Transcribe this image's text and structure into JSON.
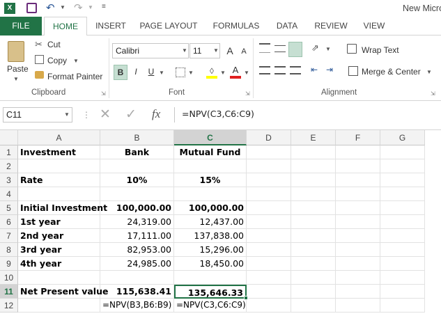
{
  "title_bar": {
    "title": "New Micro"
  },
  "tabs": [
    "FILE",
    "HOME",
    "INSERT",
    "PAGE LAYOUT",
    "FORMULAS",
    "DATA",
    "REVIEW",
    "VIEW"
  ],
  "clipboard": {
    "paste": "Paste",
    "cut": "Cut",
    "copy": "Copy",
    "format_painter": "Format Painter",
    "label": "Clipboard"
  },
  "font": {
    "name": "Calibri",
    "size": "11",
    "label": "Font",
    "grow": "A",
    "shrink": "A",
    "bold": "B",
    "italic": "I",
    "underline": "U"
  },
  "alignment": {
    "wrap_text": "Wrap Text",
    "merge_center": "Merge & Center",
    "label": "Alignment"
  },
  "formula_bar": {
    "name_box": "C11",
    "fx": "fx",
    "formula": "=NPV(C3,C6:C9)"
  },
  "columns": [
    "A",
    "B",
    "C",
    "D",
    "E",
    "F",
    "G"
  ],
  "rows": [
    "1",
    "2",
    "3",
    "4",
    "5",
    "6",
    "7",
    "8",
    "9",
    "10",
    "11",
    "12"
  ],
  "cells": {
    "A1": "Investment",
    "B1": "Bank",
    "C1": "Mutual Fund",
    "A3": "Rate",
    "B3": "10%",
    "C3": "15%",
    "A5": "Initial Investment",
    "B5": "100,000.00",
    "C5": "100,000.00",
    "A6": "1st year",
    "B6": "24,319.00",
    "C6": "12,437.00",
    "A7": "2nd year",
    "B7": "17,111.00",
    "C7": "137,838.00",
    "A8": "3rd year",
    "B8": "82,953.00",
    "C8": "15,296.00",
    "A9": "4th year",
    "B9": "24,985.00",
    "C9": "18,450.00",
    "A11": "Net Present value",
    "B11": "115,638.41",
    "C11": "135,646.33",
    "B12": "=NPV(B3,B6:B9)",
    "C12": "=NPV(C3,C6:C9)"
  },
  "colors": {
    "accent": "#217346",
    "selection": "#217346"
  }
}
